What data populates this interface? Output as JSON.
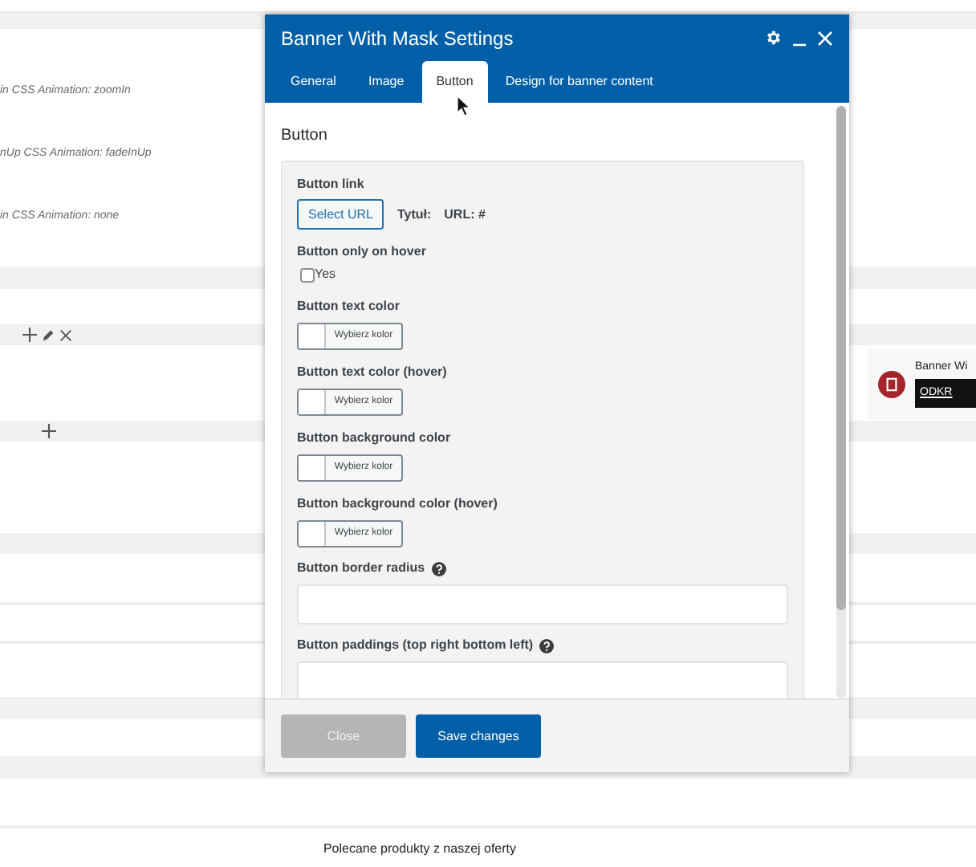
{
  "background": {
    "animation_rows": [
      "in  CSS Animation: zoomIn",
      "nUp  CSS Animation: fadeInUp",
      "in  CSS Animation: none"
    ],
    "banner_card": {
      "title": "Banner Wi",
      "button": "ODKR"
    },
    "footer_text": "Polecane produkty z naszej oferty"
  },
  "modal": {
    "title": "Banner With Mask Settings",
    "tabs": [
      {
        "label": "General",
        "selected": false
      },
      {
        "label": "Image",
        "selected": false
      },
      {
        "label": "Button",
        "selected": true
      },
      {
        "label": "Design for banner content",
        "selected": false
      }
    ],
    "section_title": "Button",
    "fields": [
      {
        "kind": "link",
        "label": "Button link",
        "button": "Select URL",
        "title_label": "Tytuł:",
        "url_label": "URL: #"
      },
      {
        "kind": "checkbox",
        "label": "Button only on hover",
        "option": "Yes",
        "checked": false
      },
      {
        "kind": "color",
        "label": "Button text color",
        "button": "Wybierz kolor"
      },
      {
        "kind": "color",
        "label": "Button text color (hover)",
        "button": "Wybierz kolor"
      },
      {
        "kind": "color",
        "label": "Button background color",
        "button": "Wybierz kolor"
      },
      {
        "kind": "color",
        "label": "Button background color (hover)",
        "button": "Wybierz kolor"
      },
      {
        "kind": "text",
        "label": "Button border radius",
        "help": true
      },
      {
        "kind": "text",
        "label": "Button paddings (top right bottom left)",
        "help": true
      }
    ],
    "buttons": [
      {
        "label": "Close",
        "kind": "secondary"
      },
      {
        "label": "Save changes",
        "kind": "primary"
      }
    ]
  }
}
